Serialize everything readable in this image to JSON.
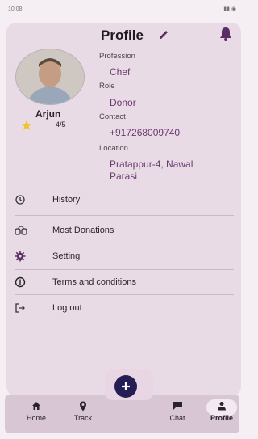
{
  "status_bar": {
    "left": "10:08",
    "right": ""
  },
  "header": {
    "title": "Profile"
  },
  "profile": {
    "name": "Arjun",
    "rating": "4/5",
    "fields": [
      {
        "label": "Profession",
        "value": "Chef"
      },
      {
        "label": "Role",
        "value": "Donor"
      },
      {
        "label": "Contact",
        "value": "+917268009740"
      },
      {
        "label": "Location",
        "value_line1": "Pratappur-4, Nawal",
        "value_line2": "Parasi"
      }
    ]
  },
  "menu": [
    {
      "label": "History",
      "icon": "history-icon"
    },
    {
      "label": "Most Donations",
      "icon": "binoculars-icon"
    },
    {
      "label": "Setting",
      "icon": "gear-icon"
    },
    {
      "label": "Terms and conditions",
      "icon": "info-icon"
    },
    {
      "label": "Log out",
      "icon": "logout-icon"
    }
  ],
  "nav": [
    {
      "label": "Home",
      "icon": "home-icon"
    },
    {
      "label": "Track",
      "icon": "location-pin-icon"
    },
    {
      "label": "Chat",
      "icon": "chat-icon"
    },
    {
      "label": "Profile",
      "icon": "person-icon"
    }
  ],
  "colors": {
    "accent": "#6a3a70",
    "fab": "#241e54",
    "card": "#e9dbe5"
  }
}
